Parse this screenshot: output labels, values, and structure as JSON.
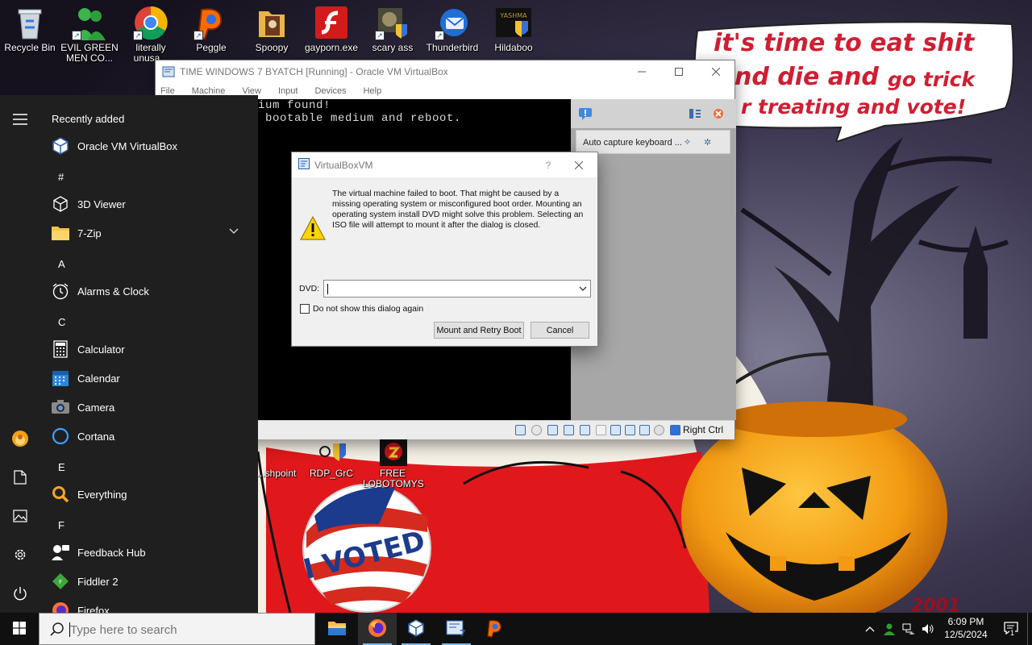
{
  "desktop_icons": [
    {
      "label": "Recycle Bin",
      "icon": "recycle-bin-icon"
    },
    {
      "label": "EVIL GREEN MEN CO...",
      "icon": "green-men-icon"
    },
    {
      "label": "literally unusa...",
      "icon": "chrome-icon"
    },
    {
      "label": "Peggle",
      "icon": "peggle-icon"
    },
    {
      "label": "Spoopy",
      "icon": "folder-icon"
    },
    {
      "label": "gayporn.exe",
      "icon": "flash-icon"
    },
    {
      "label": "scary ass",
      "icon": "shield-app-icon"
    },
    {
      "label": "Thunderbird",
      "icon": "thunderbird-icon"
    },
    {
      "label": "Hildaboo",
      "icon": "yashma-icon"
    }
  ],
  "lower_desktop_icons": [
    {
      "label": "...shpoint",
      "icon": "shortcut-icon"
    },
    {
      "label": "RDP_GrC",
      "icon": "rdp-icon"
    },
    {
      "label": "FREE LOBOTOMYS",
      "icon": "lobotomy-icon"
    }
  ],
  "wallpaper": {
    "bubble_line1": "it's time to eat shit",
    "bubble_line2a": "nd die and",
    "bubble_line2b": "go trick",
    "bubble_line3": "r treating and vote!",
    "sticker_text": "I VOTED",
    "corner_text": "2001"
  },
  "vbox_window": {
    "title": "TIME WINDOWS 7 BYATCH [Running] - Oracle VM VirtualBox",
    "menu": [
      "File",
      "Machine",
      "View",
      "Input",
      "Devices",
      "Help"
    ],
    "console_line1": "dium found!",
    "console_line2": "a bootable medium and reboot.",
    "notification": "Auto capture keyboard ...",
    "host_key": "Right Ctrl"
  },
  "dialog": {
    "title": "VirtualBoxVM",
    "help": "?",
    "message": "The virtual machine failed to boot. That might be caused by a missing operating system or misconfigured boot order. Mounting an operating system install DVD might solve this problem. Selecting an ISO file will attempt to mount it after the dialog is closed.",
    "dvd_label": "DVD:",
    "dvd_value": "",
    "checkbox_label": "Do not show this dialog again",
    "checkbox_checked": false,
    "mount_button": "Mount and Retry Boot",
    "cancel_button": "Cancel"
  },
  "start_menu": {
    "recently_added_header": "Recently added",
    "recent_apps": [
      {
        "label": "Oracle VM VirtualBox",
        "icon": "virtualbox-icon"
      }
    ],
    "groups": [
      {
        "letter": "#",
        "apps": [
          {
            "label": "3D Viewer",
            "icon": "3d-viewer-icon"
          },
          {
            "label": "7-Zip",
            "icon": "folder-icon",
            "expandable": true
          }
        ]
      },
      {
        "letter": "A",
        "apps": [
          {
            "label": "Alarms & Clock",
            "icon": "alarm-clock-icon"
          }
        ]
      },
      {
        "letter": "C",
        "apps": [
          {
            "label": "Calculator",
            "icon": "calculator-icon"
          },
          {
            "label": "Calendar",
            "icon": "calendar-icon"
          },
          {
            "label": "Camera",
            "icon": "camera-icon"
          },
          {
            "label": "Cortana",
            "icon": "cortana-icon"
          }
        ]
      },
      {
        "letter": "E",
        "apps": [
          {
            "label": "Everything",
            "icon": "everything-search-icon"
          }
        ]
      },
      {
        "letter": "F",
        "apps": [
          {
            "label": "Feedback Hub",
            "icon": "feedback-hub-icon"
          },
          {
            "label": "Fiddler 2",
            "icon": "fiddler-icon"
          },
          {
            "label": "Firefox",
            "icon": "firefox-icon"
          }
        ]
      }
    ]
  },
  "taskbar": {
    "search_placeholder": "Type here to search",
    "pinned": [
      "file-explorer-icon",
      "firefox-icon",
      "virtualbox-icon",
      "virtualbox-vm-icon",
      "peggle-icon"
    ],
    "clock_time": "6:09 PM",
    "clock_date": "12/5/2024",
    "notification_count": "1"
  },
  "colors": {
    "accent": "#0078d7",
    "start_menu_bg": "#1f1f1f",
    "taskbar_bg": "#101010",
    "bubble_text": "#d01e33"
  }
}
